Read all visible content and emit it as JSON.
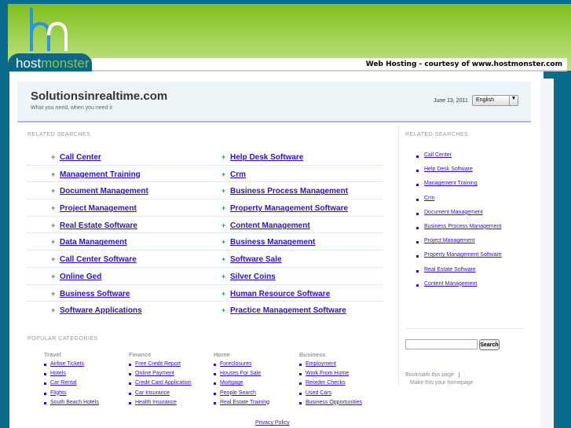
{
  "brand": {
    "logo_host": "host",
    "logo_monster": "monster",
    "courtesy": "Web Hosting - courtesy of www.hostmonster.com"
  },
  "header": {
    "site": "Solutionsinrealtime.com",
    "tagline": "What you need, when you need it",
    "date": "June 13, 2011",
    "language": "English"
  },
  "related_label": "RELATED SEARCHES",
  "related_left": [
    "Call Center",
    "Management Training",
    "Document Management",
    "Project Management",
    "Real Estate Software",
    "Data Management",
    "Call Center Software",
    "Online Ged",
    "Business Software",
    "Software Applications"
  ],
  "related_right": [
    "Help Desk Software",
    "Crm",
    "Business Process Management",
    "Property Management Software",
    "Content Management",
    "Business Management",
    "Software Sale",
    "Silver Coins",
    "Human Resource Software",
    "Practice Management Software"
  ],
  "sidebar": {
    "label": "RELATED SEARCHES",
    "items": [
      "Call Center",
      "Help Desk Software",
      "Management Training",
      "Crm",
      "Document Management",
      "Business Process Management",
      "Project Management",
      "Property Management Software",
      "Real Estate Software",
      "Content Management"
    ],
    "search_button": "Search",
    "bookmark": "Bookmark this page",
    "homepage": "Make this your homepage"
  },
  "popular": {
    "label": "POPULAR CATEGORIES",
    "categories": [
      {
        "title": "Travel",
        "items": [
          "Airline Tickets",
          "Hotels",
          "Car Rental",
          "Flights",
          "South Beach Hotels"
        ]
      },
      {
        "title": "Finance",
        "items": [
          "Free Credit Report",
          "Online Payment",
          "Credit Card Application",
          "Car Insurance",
          "Health Insurance"
        ]
      },
      {
        "title": "Home",
        "items": [
          "Foreclosures",
          "Houses For Sale",
          "Mortgage",
          "People Search",
          "Real Estate Training"
        ]
      },
      {
        "title": "Business",
        "items": [
          "Employment",
          "Work From Home",
          "Reorder Checks",
          "Used Cars",
          "Business Opportunities"
        ]
      }
    ]
  },
  "privacy": "Privacy Policy"
}
